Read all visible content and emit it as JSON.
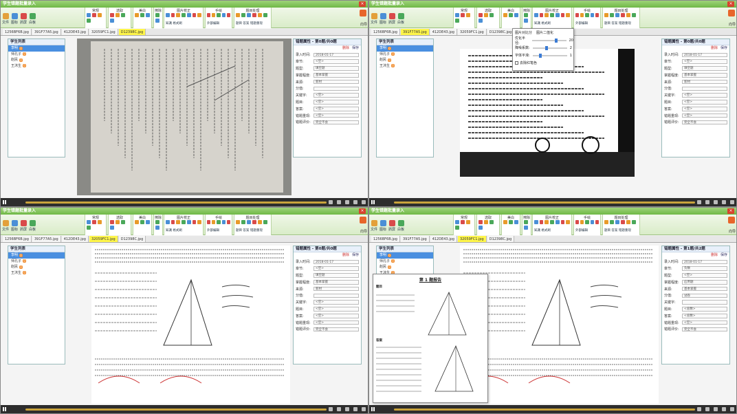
{
  "app_title": "学生错题批量录入",
  "left_buttons": [
    "文件",
    "图标",
    "抓屏",
    "白板"
  ],
  "ribbon_groups": [
    {
      "label": "常规",
      "sub": ""
    },
    {
      "label": "选取",
      "sub": ""
    },
    {
      "label": "美白",
      "sub": ""
    },
    {
      "label": "擦除",
      "sub": ""
    },
    {
      "label": "图片校正",
      "sub": "知識 格式刷"
    },
    {
      "label": "手绘",
      "sub": "外部编辑"
    },
    {
      "label": "题目处理",
      "sub": "题目 答案 错题重现"
    }
  ],
  "right_label": "向导",
  "close_label": "×",
  "tabs": [
    "1256BF6B.jpg",
    "391F77A5.jpg",
    "412DE43.jpg",
    "32059FC1.jpg",
    "D12398C.jpg"
  ],
  "students": {
    "title": "学生列表",
    "items": [
      {
        "name": "李明",
        "count": "0"
      },
      {
        "name": "师孔子",
        "count": "0"
      },
      {
        "name": "赵民",
        "count": "0"
      },
      {
        "name": "王沐生",
        "count": "0"
      }
    ]
  },
  "props_labels": [
    "录入时间:",
    "章节:",
    "题型:",
    "掌握程度:",
    "来源:",
    "分值:",
    "关键字:",
    "题目:",
    "答案:",
    "错题重现:",
    "错题评价:"
  ],
  "panes": [
    {
      "active_tab": 4,
      "props_title": "错题属性 - 第0题/共0题",
      "delete": "删除",
      "save": "保存",
      "values": [
        "2018-01-17",
        "<空>",
        "填空题",
        "基本掌握",
        "新材",
        "",
        "<空>",
        "<空>",
        "<空>",
        "<空>",
        "完全不会"
      ]
    },
    {
      "active_tab": 1,
      "props_title": "错题属性 - 第0题/共0题",
      "delete": "删除",
      "save": "保存",
      "values": [
        "2018-01-17",
        "<空>",
        "填空题",
        "基本掌握",
        "新材",
        "",
        "<空>",
        "<空>",
        "<空>",
        "<空>",
        "完全不会"
      ],
      "popup": {
        "opt1": "图片对比分",
        "opt2": "图片二值化",
        "r1": "优化半径:",
        "v1": "20",
        "r2": "降噪系数:",
        "v2": "2",
        "r3": "字体平滑:",
        "v3": "1",
        "chk": "去除红笔色"
      }
    },
    {
      "active_tab": 3,
      "props_title": "错题属性 - 第0题/共0题",
      "delete": "删除",
      "save": "保存",
      "values": [
        "2018-01-17",
        "<空>",
        "填空题",
        "基本掌握",
        "新材",
        "",
        "<空>",
        "<空>",
        "<空>",
        "<空>",
        "完全不会"
      ]
    },
    {
      "active_tab": 3,
      "props_title": "错题属性 - 第1题/共2题",
      "delete": "删除",
      "save": "保存",
      "values": [
        "2018-01-17",
        "负数",
        "<空>",
        "应用题",
        "基本掌握",
        "试卷",
        "",
        "<总数>",
        "<总数>",
        "<空>",
        "完全不会"
      ],
      "popup": {
        "title": "第 1 题报告",
        "q": "题目",
        "a": "答案"
      }
    }
  ],
  "colors": {
    "title": "#7cc04f",
    "tab_active": "#fff64a",
    "select": "#4a8fe0",
    "badge": "#f08a2a"
  }
}
